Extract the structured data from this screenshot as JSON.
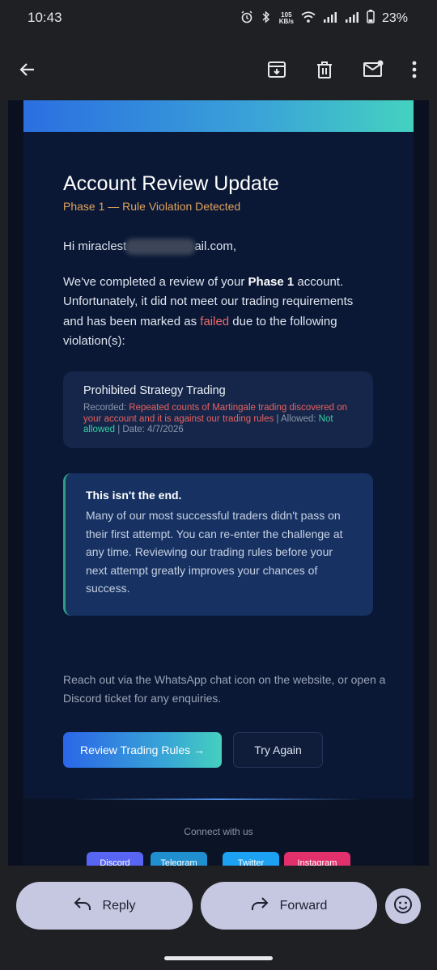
{
  "status_bar": {
    "time": "10:43",
    "net_speed_top": "105",
    "net_speed_unit": "KB/s",
    "battery": "23%"
  },
  "toolbar": {
    "icons": [
      "back-arrow-icon",
      "archive-icon",
      "delete-icon",
      "mark-unread-icon",
      "more-icon"
    ]
  },
  "email": {
    "title": "Account Review Update",
    "subtitle": "Phase 1 — Rule Violation Detected",
    "greeting_start": "Hi miraclest",
    "greeting_end": "ail.com,",
    "para_1": "We've completed a review of your ",
    "para_bold": "Phase 1",
    "para_2": " account. Unfortunately, it did not meet our trading requirements and has been marked as ",
    "para_failed": "failed",
    "para_3": " due to the following violation(s):",
    "violation": {
      "title": "Prohibited Strategy Trading",
      "recorded_label": "Recorded: ",
      "recorded_value": "Repeated counts of Martingale trading discovered on your account and it is against our trading rules",
      "sep_1": "  |  Allowed: ",
      "allowed_value": "Not allowed",
      "sep_2": "  |  Date: 4/7/2026"
    },
    "note": {
      "title": "This isn't the end.",
      "body": "Many of our most successful traders didn't pass on their first attempt. You can re-enter the challenge at any time. Reviewing our trading rules before your next attempt greatly improves your chances of success."
    },
    "reach_out": "Reach out via the WhatsApp chat icon on the website, or open a Discord ticket for any enquiries.",
    "primary_button": "Review Trading Rules →",
    "secondary_button": "Try Again",
    "footer": {
      "connect": "Connect with us",
      "social": [
        {
          "label": "Discord",
          "color": "#5865f2"
        },
        {
          "label": "Telegram",
          "color": "#1f8fcf"
        },
        {
          "label": "Twitter",
          "color": "#1da1f2"
        },
        {
          "label": "Instagram",
          "color": "#e1306c"
        }
      ]
    }
  },
  "actions": {
    "reply": "Reply",
    "forward": "Forward"
  }
}
